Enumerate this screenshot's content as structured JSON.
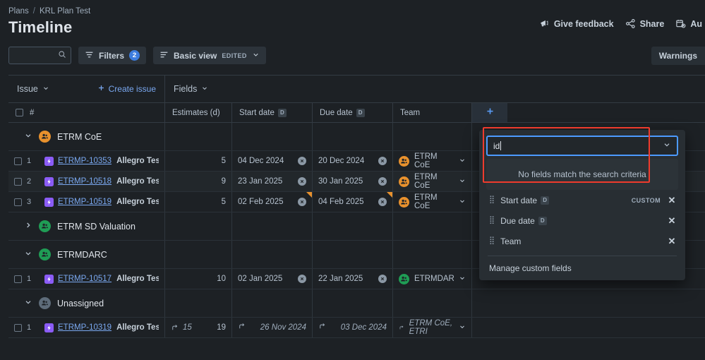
{
  "breadcrumb": {
    "root": "Plans",
    "separator": "/",
    "current": "KRL Plan Test"
  },
  "page_title": "Timeline",
  "top_actions": [
    {
      "label": "Give feedback",
      "icon": "megaphone-icon"
    },
    {
      "label": "Share",
      "icon": "share-icon"
    },
    {
      "label": "Au",
      "icon": "calendar-icon"
    }
  ],
  "toolbar": {
    "search_placeholder": "",
    "search_value": "",
    "search_icon": "search-icon",
    "filters_label": "Filters",
    "filters_count": "2",
    "view_label": "Basic view",
    "view_state": "EDITED",
    "warnings_label": "Warnings"
  },
  "grid": {
    "subheader": {
      "issue_label": "Issue",
      "create_issue_label": "Create issue",
      "fields_label": "Fields"
    },
    "columns": [
      {
        "key": "issue",
        "label": "#",
        "date_badge": ""
      },
      {
        "key": "estimates",
        "label": "Estimates (d)",
        "date_badge": ""
      },
      {
        "key": "start",
        "label": "Start date",
        "date_badge": "D"
      },
      {
        "key": "due",
        "label": "Due date",
        "date_badge": "D"
      },
      {
        "key": "team",
        "label": "Team",
        "date_badge": ""
      }
    ],
    "add_column_icon": "plus-icon",
    "groups": [
      {
        "name": "ETRM CoE",
        "expanded": true,
        "avatar_color": "#e8912d",
        "rows": [
          {
            "num": "1",
            "key": "ETRMP-10353",
            "summary": "Allegro Test …",
            "estimate": "5",
            "start": "04 Dec 2024",
            "due": "20 Dec 2024",
            "team": "ETRM CoE",
            "team_color": "#e8912d",
            "warn_start": false,
            "warn_due": false
          },
          {
            "num": "2",
            "key": "ETRMP-10518",
            "summary": "Allegro Test …",
            "estimate": "9",
            "start": "23 Jan 2025",
            "due": "30 Jan 2025",
            "team": "ETRM CoE",
            "team_color": "#e8912d",
            "warn_start": false,
            "warn_due": false
          },
          {
            "num": "3",
            "key": "ETRMP-10519",
            "summary": "Allegro Test …",
            "estimate": "5",
            "start": "02 Feb 2025",
            "due": "04 Feb 2025",
            "team": "ETRM CoE",
            "team_color": "#e8912d",
            "warn_start": true,
            "warn_due": true
          }
        ]
      },
      {
        "name": "ETRM SD Valuation",
        "expanded": false,
        "avatar_color": "#1f9d55",
        "rows": []
      },
      {
        "name": "ETRMDARC",
        "expanded": true,
        "avatar_color": "#1f9d55",
        "rows": [
          {
            "num": "1",
            "key": "ETRMP-10517",
            "summary": "Allegro Test …",
            "estimate": "10",
            "start": "02 Jan 2025",
            "due": "22 Jan 2025",
            "team": "ETRMDARC",
            "team_color": "#1f9d55",
            "warn_start": false,
            "warn_due": false
          }
        ]
      },
      {
        "name": "Unassigned",
        "expanded": true,
        "avatar_color": "#5e6c7a",
        "rows": [
          {
            "num": "1",
            "key": "ETRMP-10319",
            "summary": "Allegro Test …",
            "rollup": true,
            "rollup_estimate": "15",
            "estimate": "19",
            "start": "26 Nov 2024",
            "due": "03 Dec 2024",
            "team": "ETRM CoE, ETRI",
            "team_color": "",
            "warn_start": false,
            "warn_due": false
          }
        ]
      }
    ]
  },
  "fields_panel": {
    "search_value": "id",
    "no_results_text": "No fields match the search criteria",
    "fields": [
      {
        "label": "Start date",
        "date_badge": "D",
        "tag": "CUSTOM"
      },
      {
        "label": "Due date",
        "date_badge": "D",
        "tag": ""
      },
      {
        "label": "Team",
        "date_badge": "",
        "tag": ""
      }
    ],
    "manage_label": "Manage custom fields",
    "highlight_color": "#ef3b2d"
  }
}
